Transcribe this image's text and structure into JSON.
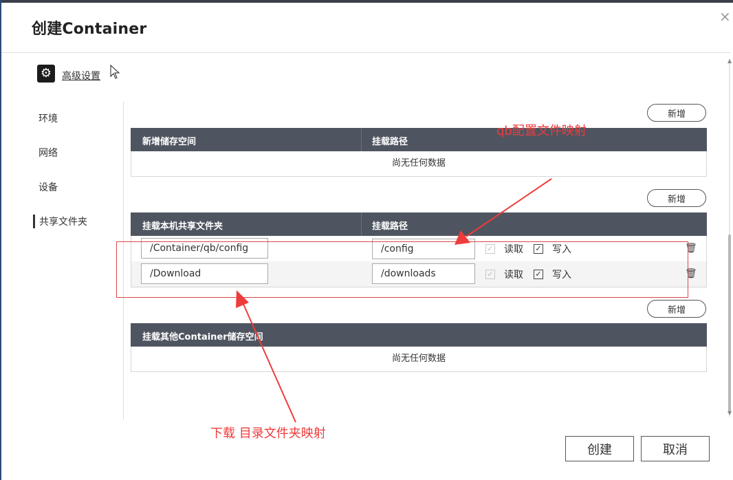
{
  "dialog": {
    "title": "创建Container",
    "close_symbol": "×"
  },
  "advanced": {
    "icon": "gear-icon",
    "label": "高级设置"
  },
  "sidebar": {
    "items": [
      {
        "label": "环境"
      },
      {
        "label": "网络"
      },
      {
        "label": "设备"
      },
      {
        "label": "共享文件夹",
        "active": true
      }
    ]
  },
  "sections": {
    "storage": {
      "add_label": "新增",
      "columns": [
        "新增储存空间",
        "挂载路径"
      ],
      "empty_text": "尚无任何数据"
    },
    "shared": {
      "add_label": "新增",
      "columns": [
        "挂载本机共享文件夹",
        "挂载路径"
      ],
      "rows": [
        {
          "host": "/Container/qb/config",
          "mount": "/config",
          "read_label": "读取",
          "write_label": "写入",
          "read": true,
          "write": true
        },
        {
          "host": "/Download",
          "mount": "/downloads",
          "read_label": "读取",
          "write_label": "写入",
          "read": true,
          "write": true
        }
      ]
    },
    "other": {
      "add_label": "新增",
      "columns": [
        "挂载其他Container储存空间"
      ],
      "empty_text": "尚无任何数据"
    }
  },
  "annotations": {
    "top": "qb配置文件映射",
    "bottom": "下载 目录文件夹映射",
    "color": "#ee3b3b"
  },
  "footer": {
    "create_label": "创建",
    "cancel_label": "取消"
  }
}
